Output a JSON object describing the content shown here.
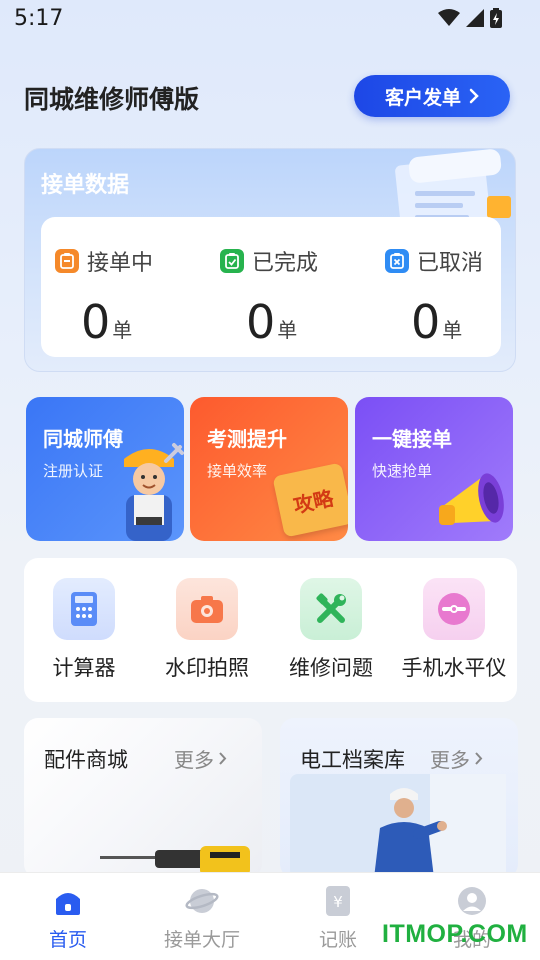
{
  "status_bar": {
    "time": "5:17"
  },
  "header": {
    "title": "同城维修师傅版",
    "client_button": "客户发单"
  },
  "stats": {
    "title": "接单数据",
    "items": [
      {
        "label": "接单中",
        "value": "0",
        "unit": "单",
        "color": "#f5892a",
        "icon": "clipboard-icon"
      },
      {
        "label": "已完成",
        "value": "0",
        "unit": "单",
        "color": "#27b34e",
        "icon": "clipboard-check-icon"
      },
      {
        "label": "已取消",
        "value": "0",
        "unit": "单",
        "color": "#2f8cf4",
        "icon": "clipboard-x-icon"
      }
    ]
  },
  "features": [
    {
      "title": "同城师傅",
      "subtitle": "注册认证",
      "color": "#3d7ff8"
    },
    {
      "title": "考测提升",
      "subtitle": "接单效率",
      "badge": "攻略",
      "color": "#fd6b3a"
    },
    {
      "title": "一键接单",
      "subtitle": "快速抢单",
      "color": "#8a5cf6"
    }
  ],
  "tools": [
    {
      "label": "计算器",
      "icon": "calculator-icon"
    },
    {
      "label": "水印拍照",
      "icon": "camera-icon"
    },
    {
      "label": "维修问题",
      "icon": "tools-icon"
    },
    {
      "label": "手机水平仪",
      "icon": "level-icon"
    }
  ],
  "shop": {
    "title": "配件商城",
    "more": "更多"
  },
  "archive": {
    "title": "电工档案库",
    "more": "更多"
  },
  "nav": [
    {
      "label": "首页",
      "active": true
    },
    {
      "label": "接单大厅",
      "active": false
    },
    {
      "label": "记账",
      "active": false
    },
    {
      "label": "我的",
      "active": false
    }
  ],
  "watermark": "ITMOP.COM"
}
